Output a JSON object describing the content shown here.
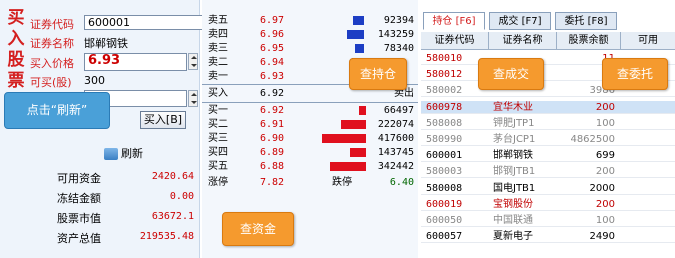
{
  "left": {
    "title_chars": [
      "买",
      "入",
      "股",
      "票"
    ],
    "code_label": "证券代码",
    "code_value": "600001",
    "name_label": "证券名称",
    "name_value": "邯郸钢铁",
    "price_label": "买入价格",
    "price_value": "6.93",
    "avail_label": "可买(股)",
    "avail_value": "300",
    "qty_value": "00",
    "buy_button": "买入[B]",
    "refresh_label": "刷新",
    "account": [
      {
        "label": "可用资金",
        "value": "2420.64"
      },
      {
        "label": "冻结金额",
        "value": "0.00"
      },
      {
        "label": "股票市值",
        "value": "63672.1"
      },
      {
        "label": "资产总值",
        "value": "219535.48"
      }
    ]
  },
  "quotes": {
    "sell": [
      {
        "label": "卖五",
        "price": "6.97",
        "volume": "92394",
        "bar": 0.25
      },
      {
        "label": "卖四",
        "price": "6.96",
        "volume": "143259",
        "bar": 0.38
      },
      {
        "label": "卖三",
        "price": "6.95",
        "volume": "78340",
        "bar": 0.2
      },
      {
        "label": "卖二",
        "price": "6.94",
        "volume": "",
        "bar": 0.28
      },
      {
        "label": "卖一",
        "price": "6.93",
        "volume": "",
        "bar": 0
      }
    ],
    "mid_left": "买入",
    "mid_price": "6.92",
    "mid_right": "卖出",
    "buy": [
      {
        "label": "买一",
        "price": "6.92",
        "volume": "66497",
        "bar": 0.15
      },
      {
        "label": "买二",
        "price": "6.91",
        "volume": "222074",
        "bar": 0.56
      },
      {
        "label": "买三",
        "price": "6.90",
        "volume": "417600",
        "bar": 1.0
      },
      {
        "label": "买四",
        "price": "6.89",
        "volume": "143745",
        "bar": 0.36
      },
      {
        "label": "买五",
        "price": "6.88",
        "volume": "342442",
        "bar": 0.82
      }
    ],
    "limit_up_label": "涨停",
    "limit_up": "7.82",
    "limit_down_label": "跌停",
    "limit_down": "6.40"
  },
  "tabs": [
    "持仓 [F6]",
    "成交 [F7]",
    "委托 [F8]"
  ],
  "table": {
    "headers": [
      "证券代码",
      "证券名称",
      "股票余额",
      "可用"
    ],
    "rows": [
      {
        "code": "580010",
        "name": "",
        "balance": "11",
        "color": "#c00000"
      },
      {
        "code": "580012",
        "name": "",
        "balance": "29",
        "color": "#c00000"
      },
      {
        "code": "580002",
        "name": "",
        "balance": "3986",
        "color": "#888888"
      },
      {
        "code": "600978",
        "name": "宜华木业",
        "balance": "200",
        "color": "#c00000"
      },
      {
        "code": "508008",
        "name": "钾肥JTP1",
        "balance": "100",
        "color": "#888888"
      },
      {
        "code": "580990",
        "name": "茅台JCP1",
        "balance": "4862500",
        "color": "#888888"
      },
      {
        "code": "600001",
        "name": "邯郸钢铁",
        "balance": "699",
        "color": "#000000"
      },
      {
        "code": "580003",
        "name": "邯钢JTB1",
        "balance": "200",
        "color": "#888888"
      },
      {
        "code": "580008",
        "name": "国电JTB1",
        "balance": "2000",
        "color": "#000000"
      },
      {
        "code": "600019",
        "name": "宝钢股份",
        "balance": "200",
        "color": "#c00000"
      },
      {
        "code": "600050",
        "name": "中国联通",
        "balance": "100",
        "color": "#888888"
      },
      {
        "code": "600057",
        "name": "夏新电子",
        "balance": "2490",
        "color": "#000000"
      }
    ]
  },
  "callouts": {
    "refresh_tip": "点击“刷新”",
    "holdings": "查持仓",
    "trades": "查成交",
    "orders": "查委托",
    "funds": "查资金"
  }
}
